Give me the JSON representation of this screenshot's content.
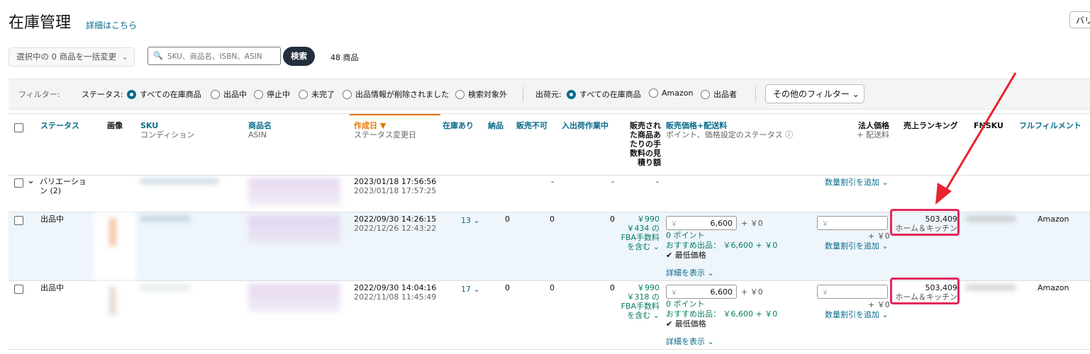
{
  "page": {
    "title": "在庫管理",
    "detail_link": "詳細はこちら",
    "top_right_button": "バリ"
  },
  "toolbar": {
    "bulk_select": "選択中の 0 商品を一括変更",
    "search_placeholder": "SKU、商品名、ISBN、ASIN",
    "search_button": "検索",
    "item_count": "48 商品"
  },
  "filters": {
    "label": "フィルター:",
    "status_label": "ステータス:",
    "status_options": [
      "すべての在庫商品",
      "出品中",
      "停止中",
      "未完了",
      "出品情報が削除されました",
      "検索対象外"
    ],
    "shipper_label": "出荷元:",
    "shipper_options": [
      "すべての在庫商品",
      "Amazon",
      "出品者"
    ],
    "other_filters": "その他のフィルター"
  },
  "columns": {
    "status": "ステータス",
    "image": "画像",
    "sku": "SKU",
    "condition": "コンディション",
    "product_name": "商品名",
    "asin": "ASIN",
    "created": "作成日 ▼",
    "status_changed": "ステータス変更日",
    "in_stock": "在庫あり",
    "inbound": "納品",
    "unfulfillable": "販売不可",
    "reserved": "入出荷作業中",
    "fee_estimate": "販売された商品あたりの手数料の見積り額",
    "price_shipping": "販売価格+配送料",
    "price_sub": "ポイント、価格設定のステータス ⓘ",
    "business_price": "法人価格",
    "business_sub": "+ 配送料",
    "sales_rank": "売上ランキング",
    "fnsku": "FNSKU",
    "fulfillment": "フルフィルメント"
  },
  "rows": [
    {
      "status": "バリエーション (2)",
      "created": "2023/01/18 17:56:56",
      "changed": "2023/01/18 17:57:25",
      "inbound": "-",
      "unfulfillable": "-",
      "reserved": "-",
      "qty_discount": "数量割引を追加 ⌄"
    },
    {
      "status": "出品中",
      "created": "2022/09/30 14:26:15",
      "changed": "2022/12/26 12:43:22",
      "stock": "13 ⌄",
      "inbound": "0",
      "unfulfillable": "0",
      "reserved": "0",
      "fee1": "￥990",
      "fee2": "￥434 の",
      "fee3": "FBA手数料",
      "fee4": "を含む ⌄",
      "yen": "￥",
      "price": "6,600",
      "ship": "+ ￥0",
      "points": "0 ポイント",
      "recommended": "おすすめ出品： ￥6,600 + ￥0",
      "lowest": "✔ 最低価格",
      "show_detail": "詳細を表示 ⌄",
      "biz_ship": "+ ￥0",
      "qty_discount": "数量割引を追加 ⌄",
      "rank": "503,409",
      "category": "ホーム＆キッチン",
      "fulfillment": "Amazon"
    },
    {
      "status": "出品中",
      "created": "2022/09/30 14:04:16",
      "changed": "2022/11/08 11:45:49",
      "stock": "17 ⌄",
      "inbound": "0",
      "unfulfillable": "0",
      "reserved": "0",
      "fee1": "￥990",
      "fee2": "￥318 の",
      "fee3": "FBA手数料",
      "fee4": "を含む ⌄",
      "yen": "￥",
      "price": "6,600",
      "ship": "+ ￥0",
      "points": "0 ポイント",
      "recommended": "おすすめ出品： ￥6,600 + ￥0",
      "lowest": "✔ 最低価格",
      "show_detail": "詳細を表示 ⌄",
      "biz_ship": "+ ￥0",
      "qty_discount": "数量割引を追加 ⌄",
      "rank": "503,409",
      "category": "ホーム＆キッチン",
      "fulfillment": "Amazon"
    }
  ],
  "colors": {
    "accent": "#0a6b8a",
    "highlight": "#e3285a",
    "arrow": "#e8232d"
  }
}
